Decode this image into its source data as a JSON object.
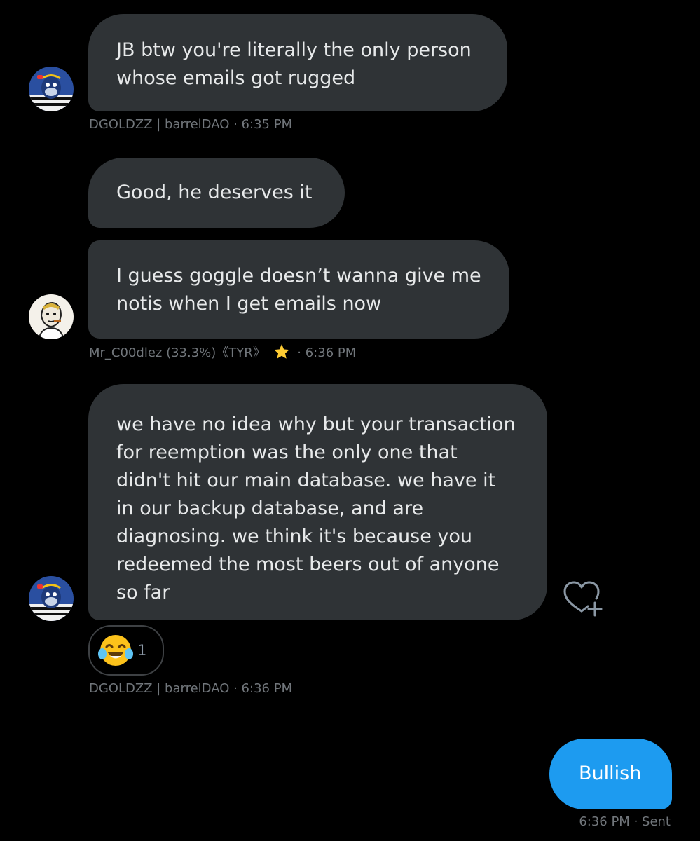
{
  "messages": [
    {
      "lines": [
        "JB btw you're literally the only person",
        "whose emails got rugged"
      ]
    },
    {
      "lines": [
        "Good, he deserves it"
      ]
    },
    {
      "lines": [
        "I guess goggle doesn’t wanna give me",
        "notis when I get emails now"
      ]
    },
    {
      "lines": [
        "we have no idea why but your transaction",
        "for reemption was the only one that",
        "didn't hit our main database. we have it",
        "in our backup database, and are",
        "diagnosing. we think it's because you",
        "redeemed the most beers out of anyone",
        "so far"
      ]
    }
  ],
  "meta": {
    "m1": {
      "sender": "DGOLDZZ | barrelDAO",
      "time": "· 6:35 PM"
    },
    "m3": {
      "sender": "Mr_C00dlez (33.3%)《TYR》",
      "time": "· 6:36 PM"
    },
    "m4": {
      "sender": "DGOLDZZ | barrelDAO",
      "time": "· 6:36 PM"
    }
  },
  "reaction": {
    "emoji": "😂",
    "count": "1"
  },
  "sent": {
    "text": "Bullish",
    "time": "6:36 PM",
    "status": "· Sent"
  },
  "colors": {
    "bubble": "#2f3336",
    "sent": "#1d9bf0",
    "meta": "#71767b",
    "background": "#000000"
  },
  "icons": {
    "react": "heart-plus-icon",
    "star": "star-icon"
  }
}
